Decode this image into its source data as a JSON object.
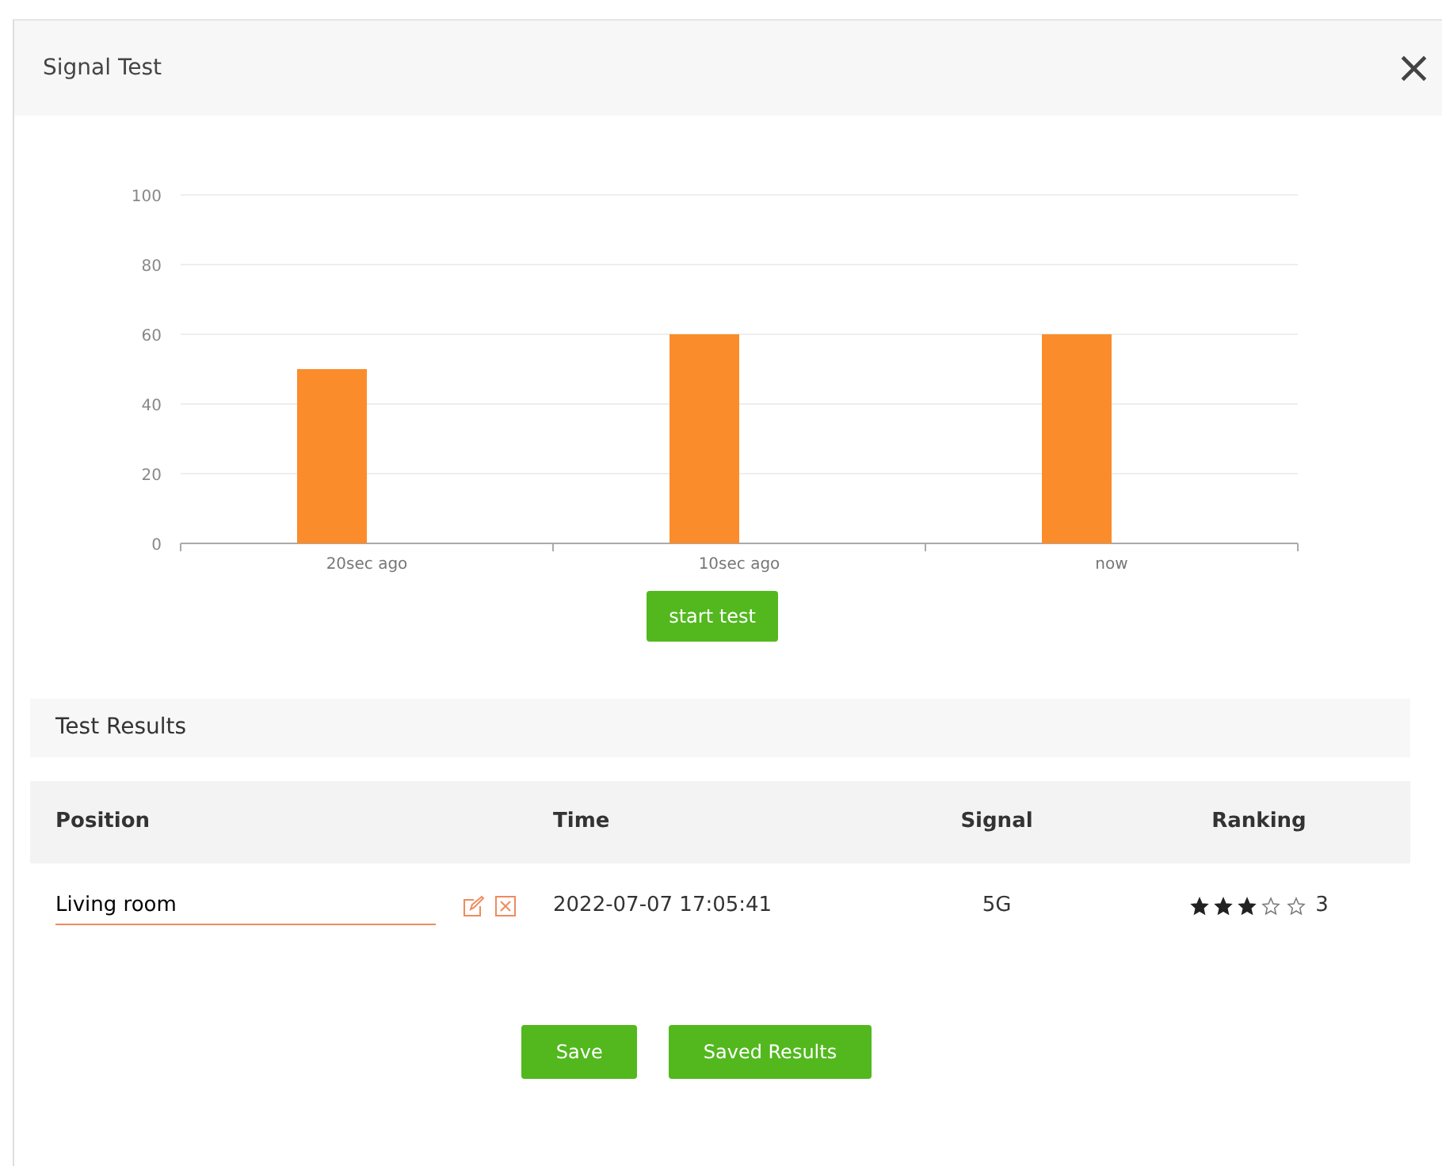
{
  "dialog": {
    "title": "Signal Test",
    "close": "×"
  },
  "chart": {
    "chart_data": {
      "type": "bar",
      "categories": [
        "20sec ago",
        "10sec ago",
        "now"
      ],
      "grid": true,
      "series": [
        {
          "color": "#fb8c2b",
          "values": [
            50,
            60,
            60
          ]
        }
      ],
      "ylim": [
        0,
        100
      ],
      "yticks": [
        0,
        20,
        40,
        60,
        80,
        100
      ]
    }
  },
  "start_button": "start test",
  "results": {
    "title": "Test Results",
    "columns": [
      "Position",
      "Time",
      "Signal",
      "Ranking"
    ],
    "rows": [
      {
        "position": "Living room",
        "time": "2022-07-07 17:05:41",
        "signal": "5G",
        "stars": 3,
        "ranking": "3"
      }
    ]
  },
  "buttons": [
    "Save",
    "Saved Results"
  ]
}
